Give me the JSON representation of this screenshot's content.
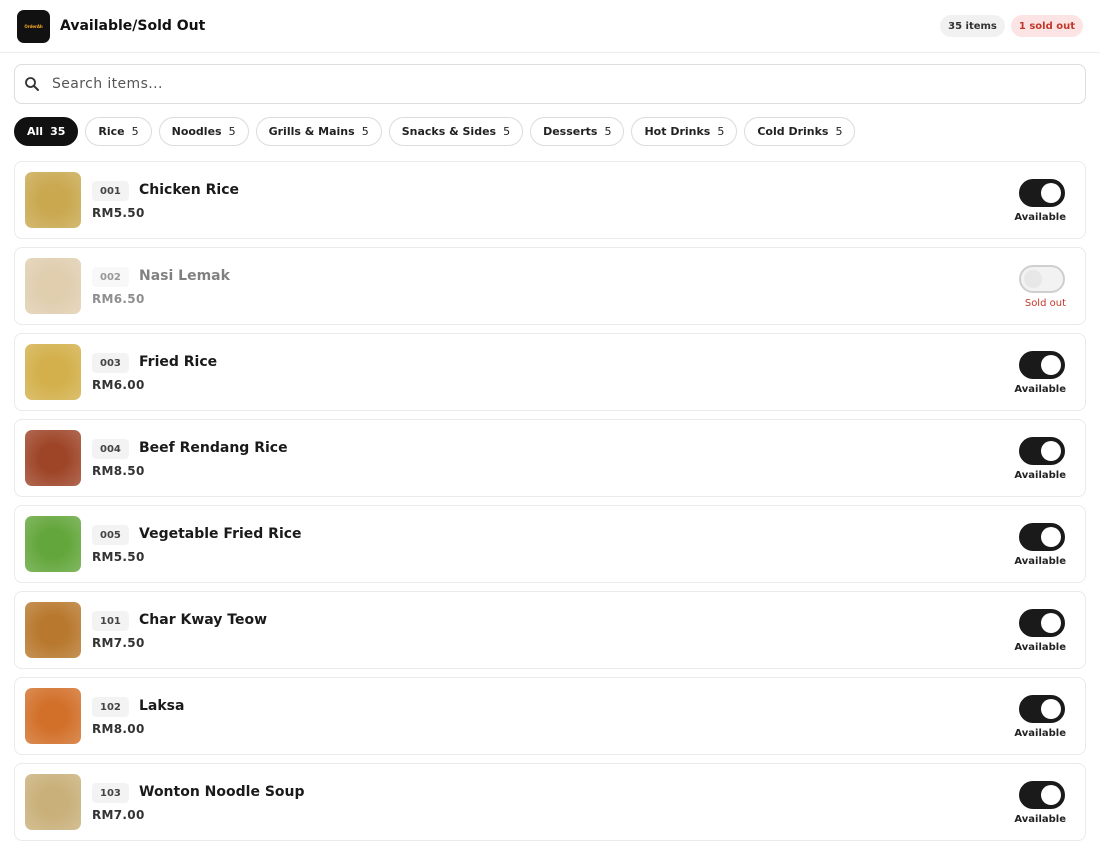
{
  "header": {
    "logo_text": "OrderAh",
    "title": "Available/Sold Out",
    "items_count": "35 items",
    "sold_out_count": "1 sold out"
  },
  "search": {
    "placeholder": "Search items..."
  },
  "tabs": [
    {
      "label": "All",
      "count": "35",
      "active": true
    },
    {
      "label": "Rice",
      "count": "5"
    },
    {
      "label": "Noodles",
      "count": "5"
    },
    {
      "label": "Grills & Mains",
      "count": "5"
    },
    {
      "label": "Snacks & Sides",
      "count": "5"
    },
    {
      "label": "Desserts",
      "count": "5"
    },
    {
      "label": "Hot Drinks",
      "count": "5"
    },
    {
      "label": "Cold Drinks",
      "count": "5"
    }
  ],
  "items": [
    {
      "code": "001",
      "name": "Chicken Rice",
      "price": "RM5.50",
      "status": "Available",
      "available": true,
      "color": "#c9a84f"
    },
    {
      "code": "002",
      "name": "Nasi Lemak",
      "price": "RM6.50",
      "status": "Sold out",
      "available": false,
      "color": "#c6a56d"
    },
    {
      "code": "003",
      "name": "Fried Rice",
      "price": "RM6.00",
      "status": "Available",
      "available": true,
      "color": "#d3b04b"
    },
    {
      "code": "004",
      "name": "Beef Rendang Rice",
      "price": "RM8.50",
      "status": "Available",
      "available": true,
      "color": "#9e4528"
    },
    {
      "code": "005",
      "name": "Vegetable Fried Rice",
      "price": "RM5.50",
      "status": "Available",
      "available": true,
      "color": "#63a63b"
    },
    {
      "code": "101",
      "name": "Char Kway Teow",
      "price": "RM7.50",
      "status": "Available",
      "available": true,
      "color": "#b8782d"
    },
    {
      "code": "102",
      "name": "Laksa",
      "price": "RM8.00",
      "status": "Available",
      "available": true,
      "color": "#d2702a"
    },
    {
      "code": "103",
      "name": "Wonton Noodle Soup",
      "price": "RM7.00",
      "status": "Available",
      "available": true,
      "color": "#c9b07a"
    }
  ]
}
